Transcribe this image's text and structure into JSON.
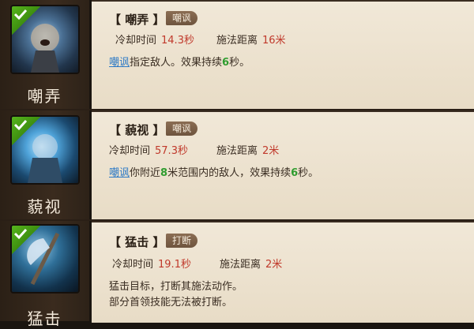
{
  "skills": [
    {
      "icon_name": "roaring-warrior-icon",
      "name": "嘲弄",
      "title": "【 嘲弄 】",
      "tag": "嘲讽",
      "cooldown_label": "冷却时间",
      "cooldown_value": "14.3秒",
      "range_label": "施法距离",
      "range_value": "16米",
      "desc": [
        {
          "t": "嘲讽",
          "c": "kw"
        },
        {
          "t": "指定敌人。效果持续"
        },
        {
          "t": "6",
          "c": "num"
        },
        {
          "t": "秒。"
        }
      ]
    },
    {
      "icon_name": "glowing-dwarf-icon",
      "name": "藐视",
      "title": "【 藐视 】",
      "tag": "嘲讽",
      "cooldown_label": "冷却时间",
      "cooldown_value": "57.3秒",
      "range_label": "施法距离",
      "range_value": "2米",
      "desc": [
        {
          "t": "嘲讽",
          "c": "kw"
        },
        {
          "t": "你附近"
        },
        {
          "t": "8",
          "c": "num"
        },
        {
          "t": "米范围内的敌人，效果持续"
        },
        {
          "t": "6",
          "c": "num"
        },
        {
          "t": "秒。"
        }
      ]
    },
    {
      "icon_name": "axe-strike-icon",
      "name": "猛击",
      "title": "【 猛击 】",
      "tag": "打断",
      "cooldown_label": "冷却时间",
      "cooldown_value": "19.1秒",
      "range_label": "施法距离",
      "range_value": "2米",
      "desc_lines": [
        "猛击目标，打断其施法动作。",
        "部分首领技能无法被打断。"
      ]
    }
  ],
  "colors": {
    "accent_value": "#c0392b",
    "keyword": "#2e7ac6",
    "number": "#2f9c2f",
    "check": "#57b51d"
  }
}
